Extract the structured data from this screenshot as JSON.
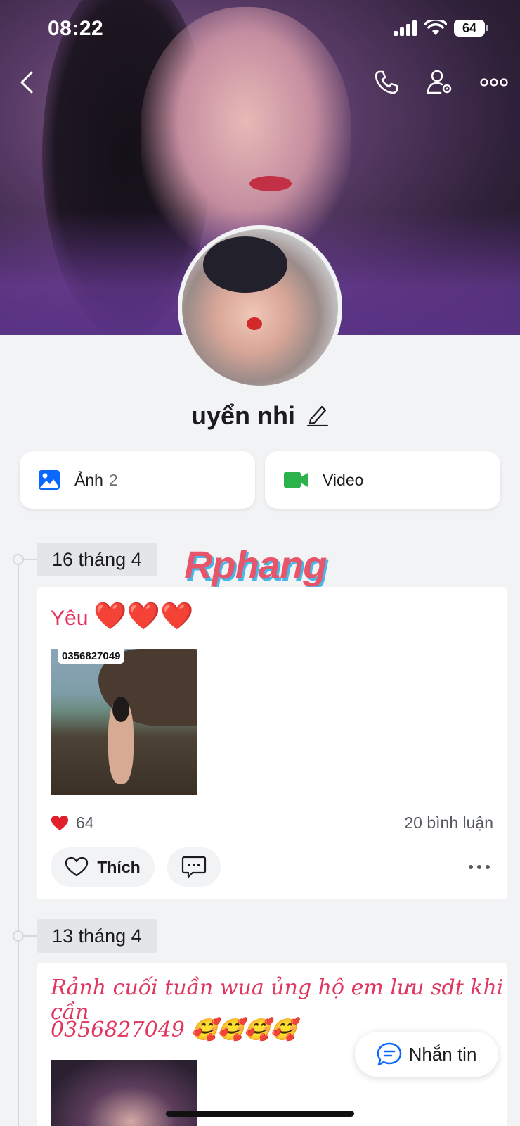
{
  "status_bar": {
    "time": "08:22",
    "battery": "64"
  },
  "profile": {
    "name": "uyển nhi"
  },
  "media": {
    "photos_label": "Ảnh",
    "photos_count": "2",
    "video_label": "Video"
  },
  "watermark": "Rphang",
  "posts": [
    {
      "date": "16 tháng 4",
      "text": "Yêu",
      "hearts": "❤️❤️❤️",
      "photo_tag": "0356827049",
      "likes": "64",
      "comments": "20 bình luận",
      "like_label": "Thích"
    },
    {
      "date": "13 tháng 4",
      "line1": "Rảnh cuối tuần wua ủng hộ em lưu sdt khi cần",
      "line2": "0356827049 🥰🥰🥰🥰"
    }
  ],
  "message_button": "Nhắn tin",
  "colors": {
    "accent_blue": "#0a68ff",
    "video_green": "#2bb24c",
    "post_pink": "#e0365f",
    "heart_red": "#e0202a"
  },
  "icons": [
    "back-icon",
    "phone-icon",
    "user-settings-icon",
    "more-icon",
    "edit-icon",
    "photo-icon",
    "video-icon",
    "heart-icon",
    "comment-icon",
    "message-icon"
  ]
}
